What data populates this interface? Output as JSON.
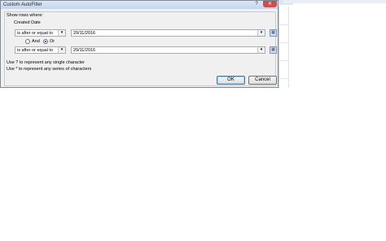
{
  "dialog": {
    "title": "Custom AutoFilter",
    "help": "?",
    "close": "✕"
  },
  "show_rows_label": "Show rows where:",
  "field_label": "Created Date",
  "criteria1": {
    "operator": "is after or equal to",
    "value": "29/11/2016"
  },
  "criteria2": {
    "operator": "is after or equal to",
    "value": "29/11/2016"
  },
  "logic": {
    "and_label": "And",
    "or_label": "Or",
    "selected": "Or"
  },
  "hints": [
    "Use ? to represent any single character",
    "Use * to represent any series of characters"
  ],
  "buttons": {
    "ok": "OK",
    "cancel": "Cancel"
  },
  "icons": {
    "dropdown": "chevron-down-icon",
    "date_picker": "calendar-icon"
  }
}
